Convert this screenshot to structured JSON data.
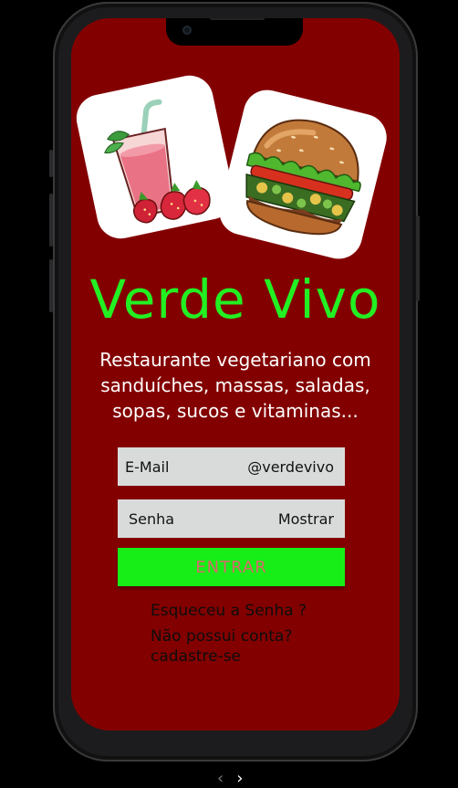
{
  "app": {
    "title": "Verde Vivo",
    "subtitle": "Restaurante vegetariano com sanduíches, massas, saladas, sopas, sucos e vitaminas..."
  },
  "form": {
    "email_label": "E-Mail",
    "email_value": "@verdevivo",
    "password_label": "Senha",
    "show_label": "Mostrar",
    "submit_label": "ENTRAR"
  },
  "links": {
    "forgot": "Esqueceu a Senha ?",
    "signup": "Não possui conta? cadastre-se"
  },
  "pager": {
    "prev": "‹",
    "next": "›"
  },
  "colors": {
    "background": "#830000",
    "title": "#22f022",
    "button": "#17ee17",
    "button_text": "#d36a6a",
    "field": "#d9dbdb"
  },
  "icons": [
    "juice-glass-icon",
    "burger-icon",
    "chevron-left-icon",
    "chevron-right-icon"
  ]
}
